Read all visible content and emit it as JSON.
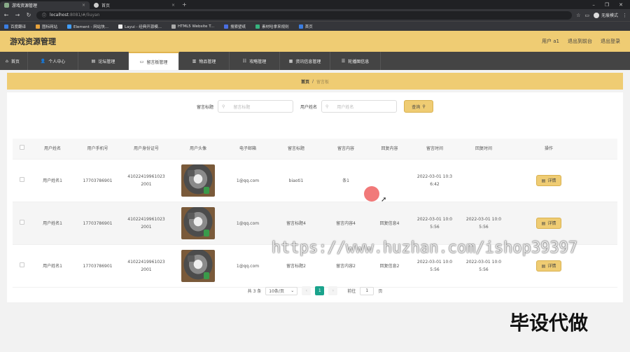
{
  "browser": {
    "tabs": [
      {
        "label": "游戏资源管理",
        "active": true
      },
      {
        "label": "首页",
        "active": false
      }
    ],
    "url_host": "localhost",
    "url_rest": ":8081/#/liuyan",
    "profile": "无痕模式",
    "bookmarks": [
      "百度翻译",
      "图标网站",
      "Element - 网站快...",
      "Layui - 经典开源模...",
      "HTML5 Website T...",
      "搜索壁纸",
      "素材哈拿来规则",
      "首页"
    ]
  },
  "header": {
    "title": "游戏资源管理",
    "user": "用户 a1",
    "back": "退出到前台",
    "logout": "退出登录"
  },
  "menu": [
    {
      "label": "首页",
      "icon": "home-icon"
    },
    {
      "label": "个人中心",
      "icon": "user-icon"
    },
    {
      "label": "论坛管理",
      "icon": "forum-icon"
    },
    {
      "label": "留言板管理",
      "icon": "message-icon",
      "active": true
    },
    {
      "label": "物品管理",
      "icon": "chart-icon"
    },
    {
      "label": "攻略管理",
      "icon": "guide-icon"
    },
    {
      "label": "资讯信息管理",
      "icon": "news-icon"
    },
    {
      "label": "轮播图信息",
      "icon": "carousel-icon"
    }
  ],
  "breadcrumb": {
    "home": "首页",
    "sep": "/",
    "current": "留言板"
  },
  "search": {
    "label1": "留言标题",
    "placeholder1": "留言标题",
    "label2": "用户姓名",
    "placeholder2": "用户姓名",
    "button": "查询"
  },
  "table": {
    "headers": [
      "用户姓名",
      "用户手机号",
      "用户身份证号",
      "用户头像",
      "电子邮箱",
      "留言标题",
      "留言内容",
      "回复内容",
      "留言时间",
      "回复时间",
      "操作"
    ],
    "rows": [
      {
        "name": "用户姓名1",
        "phone": "17703786901",
        "id1": "41022419961023",
        "id2": "2001",
        "email": "1@qq.com",
        "title": "biaoti1",
        "content": "条1",
        "reply": "",
        "time1": "2022-03-01 10:3",
        "time2": "6:42",
        "rtime1": "",
        "rtime2": "",
        "action": "详情"
      },
      {
        "name": "用户姓名1",
        "phone": "17703786901",
        "id1": "41022419961023",
        "id2": "2001",
        "email": "1@qq.com",
        "title": "留言标题4",
        "content": "留言内容4",
        "reply": "回复信息4",
        "time1": "2022-03-01 10:0",
        "time2": "5:56",
        "rtime1": "2022-03-01 10:0",
        "rtime2": "5:56",
        "action": "详情"
      },
      {
        "name": "用户姓名1",
        "phone": "17703786901",
        "id1": "41022419961023",
        "id2": "2001",
        "email": "1@qq.com",
        "title": "留言标题2",
        "content": "留言内容2",
        "reply": "回复信息2",
        "time1": "2022-03-01 10:0",
        "time2": "5:56",
        "rtime1": "2022-03-01 10:0",
        "rtime2": "5:56",
        "action": "详情"
      }
    ]
  },
  "pager": {
    "total": "共 3 条",
    "size": "10条/页",
    "page": "1",
    "goto": "前往",
    "goto_val": "1",
    "unit": "页"
  },
  "watermark": "https://www.huzhan.com/ishop39397",
  "overlay": "毕设代做"
}
